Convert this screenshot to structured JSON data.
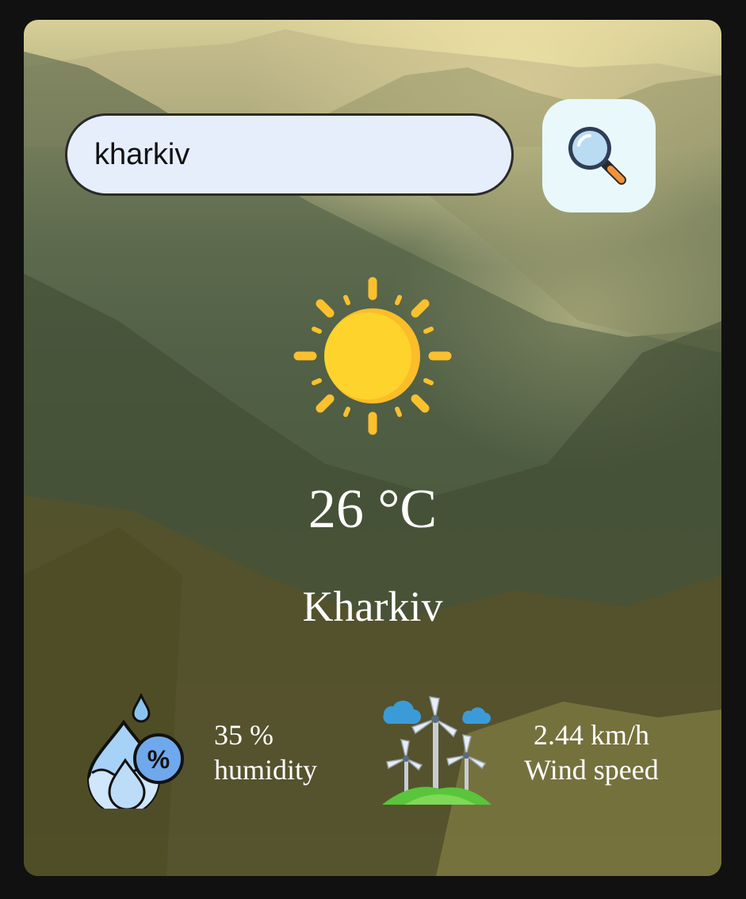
{
  "search": {
    "value": "kharkiv",
    "button_icon": "magnifier-icon"
  },
  "weather": {
    "icon": "sun-icon",
    "temperature": "26 °C",
    "city": "Kharkiv"
  },
  "details": {
    "humidity": {
      "value": "35 %",
      "label": "humidity",
      "icon": "humidity-icon"
    },
    "wind": {
      "value": "2.44 km/h",
      "label": "Wind speed",
      "icon": "wind-turbine-icon"
    }
  },
  "colors": {
    "page_background": "#111111",
    "search_field": "#e6eefc",
    "search_button": "#e8f8fb",
    "sun": "#fccf2a",
    "text": "#ffffff"
  }
}
